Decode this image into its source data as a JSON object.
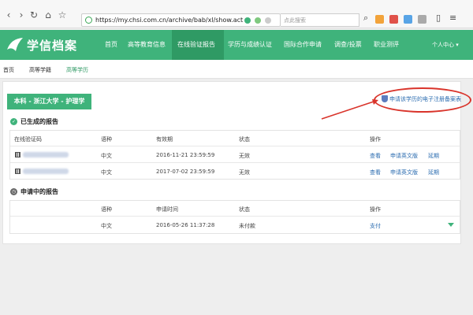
{
  "browser": {
    "url": "https://my.chsi.com.cn/archive/bab/xl/show.act",
    "search_placeholder": "点此搜索"
  },
  "header": {
    "logo_text": "学信档案",
    "menu": [
      "首页",
      "高等教育信息",
      "在线验证报告",
      "学历与成绩认证",
      "国际合作申请",
      "调查/投票",
      "职业测评"
    ],
    "user_menu": "个人中心 ▾"
  },
  "sub_nav": [
    "首页",
    "高等学籍",
    "高等学历"
  ],
  "panel": {
    "school_tag": "本科 - 浙江大学 - 护理学",
    "apply_link": "申请该学历的电子注册备案表"
  },
  "generated": {
    "title": "已生成的报告",
    "headers": [
      "在线验证码",
      "语种",
      "有效期",
      "状态",
      "操作"
    ],
    "rows": [
      {
        "language": "中文",
        "expiry": "2016-11-21 23:59:59",
        "status": "无效",
        "actions": [
          "查看",
          "申请英文版",
          "延期"
        ]
      },
      {
        "language": "中文",
        "expiry": "2017-07-02 23:59:59",
        "status": "无效",
        "actions": [
          "查看",
          "申请英文版",
          "延期"
        ]
      }
    ]
  },
  "pending": {
    "title": "申请中的报告",
    "headers": [
      "语种",
      "申请时间",
      "状态",
      "操作"
    ],
    "rows": [
      {
        "language": "中文",
        "applied": "2016-05-26 11:37:28",
        "status": "未付款",
        "action": "支付"
      }
    ]
  },
  "colors": {
    "brand_green": "#3fb37b",
    "link_blue": "#2b6cb0",
    "annotation_red": "#d9342b"
  }
}
